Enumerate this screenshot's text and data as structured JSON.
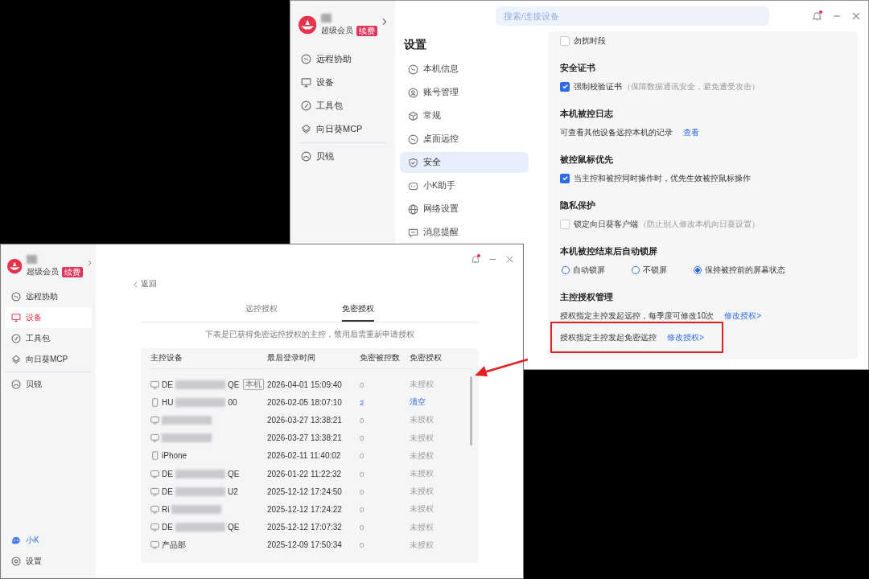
{
  "top_window": {
    "account": {
      "tier": "超级会员",
      "badge": "续费"
    },
    "search": {
      "placeholder": "搜索/连接设备"
    },
    "notification_dot": true,
    "sidebar": [
      {
        "label": "远程协助",
        "selected": false
      },
      {
        "label": "设备",
        "selected": false
      },
      {
        "label": "工具包",
        "selected": false
      },
      {
        "label": "向日葵MCP",
        "selected": false
      },
      {
        "label": "贝锐",
        "selected": false
      }
    ],
    "settings_title": "设置",
    "settings_nav": [
      {
        "label": "本机信息",
        "selected": false
      },
      {
        "label": "账号管理",
        "selected": false
      },
      {
        "label": "常规",
        "selected": false
      },
      {
        "label": "桌面远控",
        "selected": false
      },
      {
        "label": "安全",
        "selected": true
      },
      {
        "label": "小K助手",
        "selected": false
      },
      {
        "label": "网络设置",
        "selected": false
      },
      {
        "label": "消息提醒",
        "selected": false
      }
    ],
    "sections": [
      {
        "rows": [
          {
            "kind": "checkbox",
            "label": "勿扰时段",
            "checked": false
          }
        ]
      },
      {
        "title": "安全证书",
        "rows": [
          {
            "kind": "checkbox",
            "label": "强制校验证书",
            "note": "（保障数据通讯安全，避免遭受攻击）",
            "checked": true
          }
        ]
      },
      {
        "title": "本机被控日志",
        "rows": [
          {
            "kind": "text",
            "text": "可查看其他设备远控本机的记录",
            "link": "查看"
          }
        ]
      },
      {
        "title": "被控鼠标优先",
        "rows": [
          {
            "kind": "checkbox",
            "label": "当主控和被控同时操作时，优先生效被控鼠标操作",
            "checked": true
          }
        ]
      },
      {
        "title": "隐私保护",
        "rows": [
          {
            "kind": "checkbox",
            "label": "锁定向日葵客户端",
            "note": "（防止别人修改本机向日葵设置）",
            "checked": false
          }
        ]
      },
      {
        "title": "本机被控结束后自动锁屏",
        "rows": [
          {
            "kind": "radio",
            "options": [
              {
                "label": "自动锁屏",
                "selected": false
              },
              {
                "label": "不锁屏",
                "selected": false
              },
              {
                "label": "保持被控前的屏幕状态",
                "selected": true
              }
            ]
          }
        ]
      },
      {
        "title": "主控授权管理",
        "rows": [
          {
            "kind": "text",
            "text": "授权指定主控发起远控，每季度可修改10次",
            "link": "修改授权>",
            "highlighted": false
          },
          {
            "kind": "text",
            "text": "授权指定主控发起免密远控",
            "link": "修改授权>",
            "highlighted": true
          }
        ]
      }
    ]
  },
  "bottom_window": {
    "account": {
      "tier": "超级会员",
      "badge": "续费"
    },
    "notification_dot": true,
    "sidebar": [
      {
        "label": "远程协助",
        "selected": false
      },
      {
        "label": "设备",
        "selected": true
      },
      {
        "label": "工具包",
        "selected": false
      },
      {
        "label": "向日葵MCP",
        "selected": false
      },
      {
        "label": "贝锐",
        "selected": false
      }
    ],
    "sidebar_footer": [
      {
        "label": "小K",
        "kind": "assistant"
      },
      {
        "label": "设置",
        "kind": "settings"
      }
    ],
    "back": "返回",
    "tabs": [
      {
        "label": "远控授权",
        "selected": false
      },
      {
        "label": "免密授权",
        "selected": true
      }
    ],
    "description": "下表是已获得免密远控授权的主控，禁用后需重新申请授权",
    "table": {
      "columns": [
        "主控设备",
        "最后登录时间",
        "免密被控数",
        "免密授权"
      ],
      "rows": [
        {
          "kind": "desktop",
          "name_start": "DE",
          "redacted": true,
          "name_end": "QE",
          "tag": "本机",
          "last_login": "2026-04-01 15:09:40",
          "count": "0",
          "auth": "未授权",
          "authorized": false
        },
        {
          "kind": "phone",
          "name_start": "HU",
          "redacted": true,
          "name_end": "00",
          "last_login": "2026-02-05 18:07:10",
          "count": "2",
          "auth": "清空",
          "authorized": true
        },
        {
          "kind": "desktop",
          "redacted": true,
          "last_login": "2026-03-27 13:38:21",
          "count": "0",
          "auth": "未授权",
          "authorized": false
        },
        {
          "kind": "desktop",
          "redacted": true,
          "last_login": "2026-03-27 13:38:21",
          "count": "0",
          "auth": "未授权",
          "authorized": false
        },
        {
          "kind": "phone",
          "name_start": "iPhone",
          "redacted": false,
          "last_login": "2026-02-11 11:40:02",
          "count": "0",
          "auth": "未授权",
          "authorized": false
        },
        {
          "kind": "desktop",
          "name_start": "DE",
          "redacted": true,
          "name_end": "QE",
          "last_login": "2026-01-22 11:22:32",
          "count": "0",
          "auth": "未授权",
          "authorized": false
        },
        {
          "kind": "desktop",
          "name_start": "DE",
          "redacted": true,
          "name_end": "U2",
          "last_login": "2025-12-12 17:24:50",
          "count": "0",
          "auth": "未授权",
          "authorized": false
        },
        {
          "kind": "desktop",
          "name_start": "Ri",
          "redacted": true,
          "last_login": "2025-12-12 17:24:22",
          "count": "0",
          "auth": "未授权",
          "authorized": false
        },
        {
          "kind": "desktop",
          "name_start": "DE",
          "redacted": true,
          "name_end": "QE",
          "last_login": "2025-12-12 17:07:32",
          "count": "0",
          "auth": "未授权",
          "authorized": false
        },
        {
          "kind": "desktop",
          "name_start": "产品部",
          "redacted": false,
          "last_login": "2025-12-09 17:50:34",
          "count": "0",
          "auth": "未授权",
          "authorized": false
        }
      ]
    }
  }
}
